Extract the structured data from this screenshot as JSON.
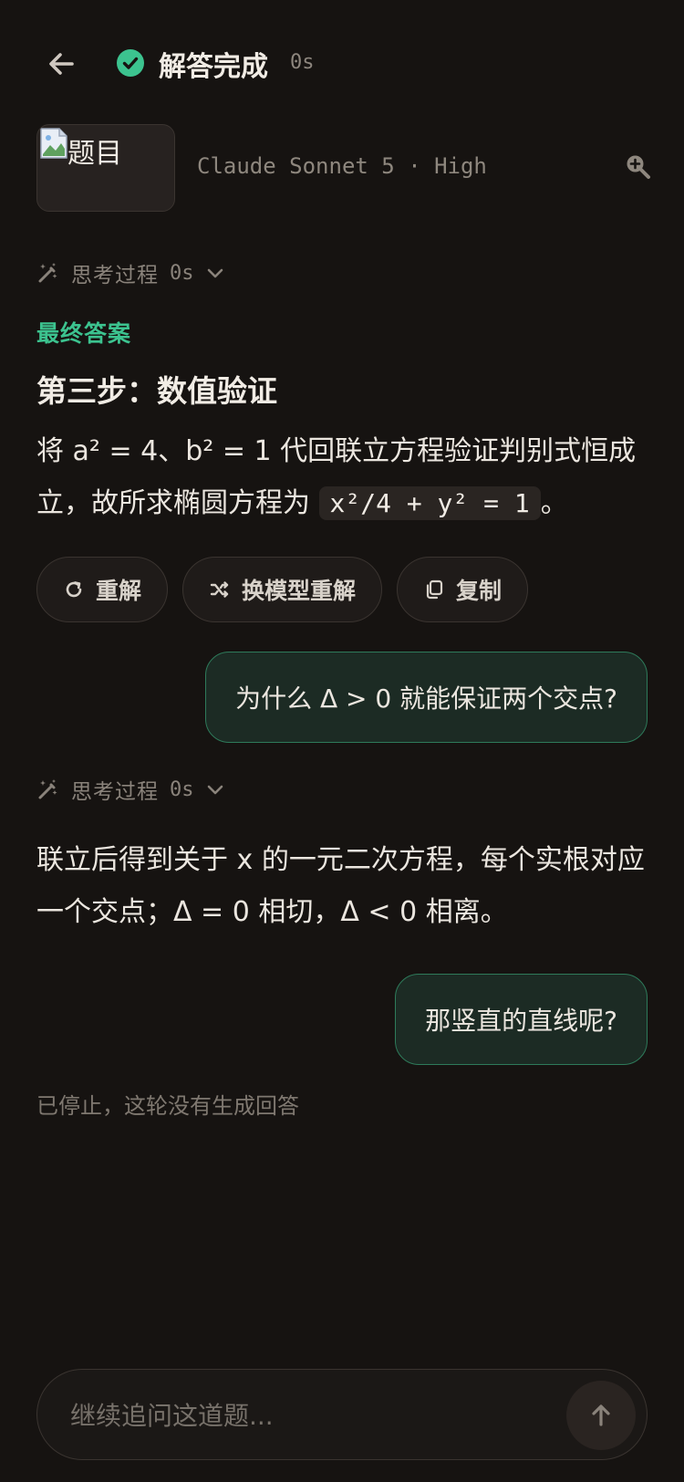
{
  "header": {
    "title": "解答完成",
    "elapsed": "0s",
    "status_color": "#3cc38f"
  },
  "thumbnail": {
    "alt": "题目"
  },
  "model": {
    "label": "Claude Sonnet 5 · High"
  },
  "thinking": [
    {
      "label": "思考过程",
      "time": "0s"
    },
    {
      "label": "思考过程",
      "time": "0s"
    }
  ],
  "answer": {
    "final_label": "最终答案",
    "step_title": "第三步：数值验证",
    "text_before": "将 a² = 4、b² = 1 代回联立方程验证判别式恒成立，故所求椭圆方程为 ",
    "code": "x²/4 + y² = 1",
    "text_after": "。"
  },
  "actions": {
    "retry": "重解",
    "switch_model": "换模型重解",
    "copy": "复制"
  },
  "messages": [
    {
      "role": "user",
      "text": "为什么 Δ > 0 就能保证两个交点?"
    },
    {
      "role": "assistant",
      "text": "联立后得到关于 x 的一元二次方程，每个实根对应一个交点；Δ = 0 相切，Δ < 0 相离。"
    },
    {
      "role": "user",
      "text": "那竖直的直线呢?"
    }
  ],
  "status": {
    "stopped": "已停止，这轮没有生成回答"
  },
  "composer": {
    "placeholder": "继续追问这道题..."
  },
  "icons": {
    "back": "arrow-left-icon",
    "status": "check-circle-icon",
    "zoom": "zoom-in-icon",
    "thinking": "magic-wand-icon",
    "expand": "chevron-down-icon",
    "retry": "refresh-icon",
    "switch": "shuffle-icon",
    "copy": "copy-icon",
    "send": "arrow-up-icon"
  }
}
